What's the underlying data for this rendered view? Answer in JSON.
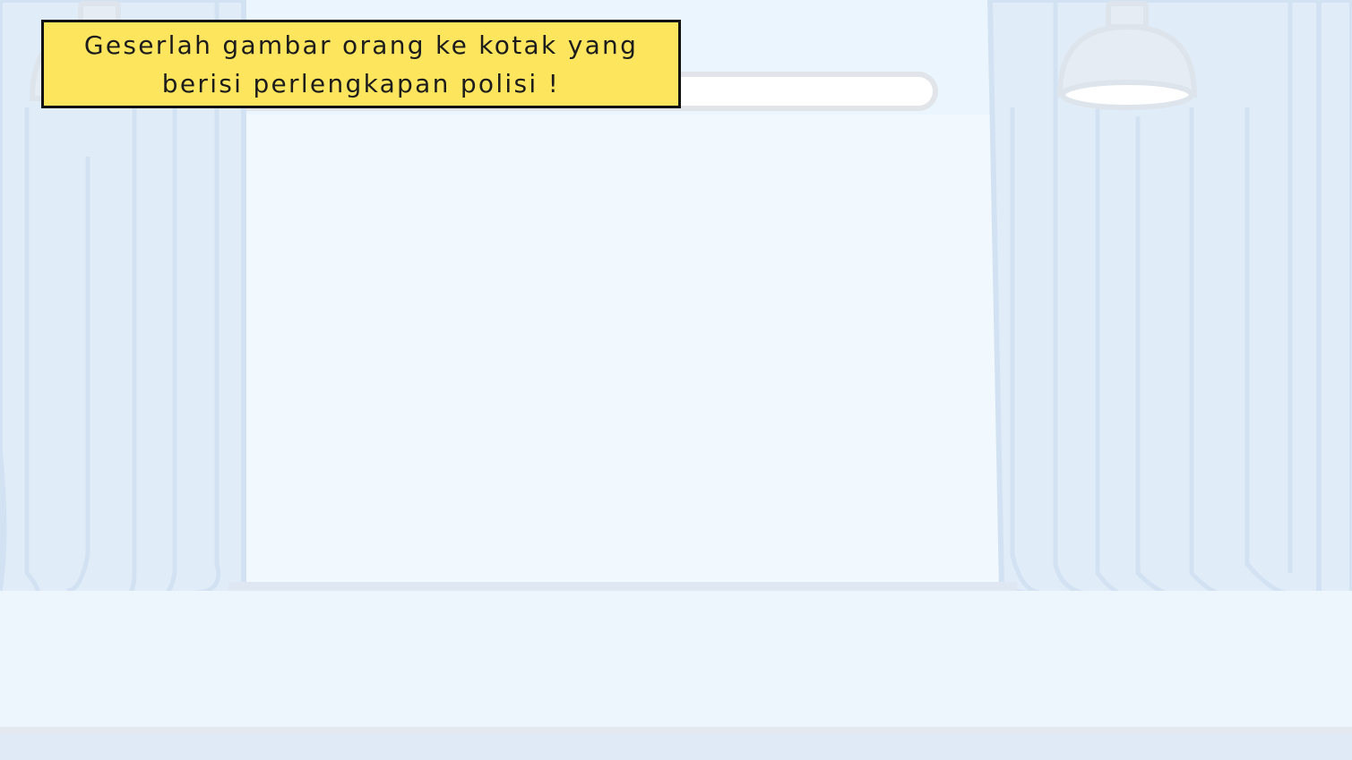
{
  "scene": {
    "name": "stage-with-curtains",
    "colors": {
      "wall": "#eaf5fd",
      "screen": "#f1f8fe",
      "curtain": "#deeaf7",
      "curtain_line": "#d2e1f1",
      "floor": "#edf5fd",
      "baseboard": "#dde8f3",
      "lamp": "#e6ecf3",
      "lamp_light": "#ffffff",
      "rail": "#e1e6ec"
    },
    "icons": [
      "ceiling-lamp-icon",
      "curtain-rod-icon"
    ]
  },
  "instruction": {
    "text": "Geserlah gambar orang ke kotak yang\nberisi perlengkapan polisi !",
    "background": "#fde55e",
    "border": "#111111"
  }
}
